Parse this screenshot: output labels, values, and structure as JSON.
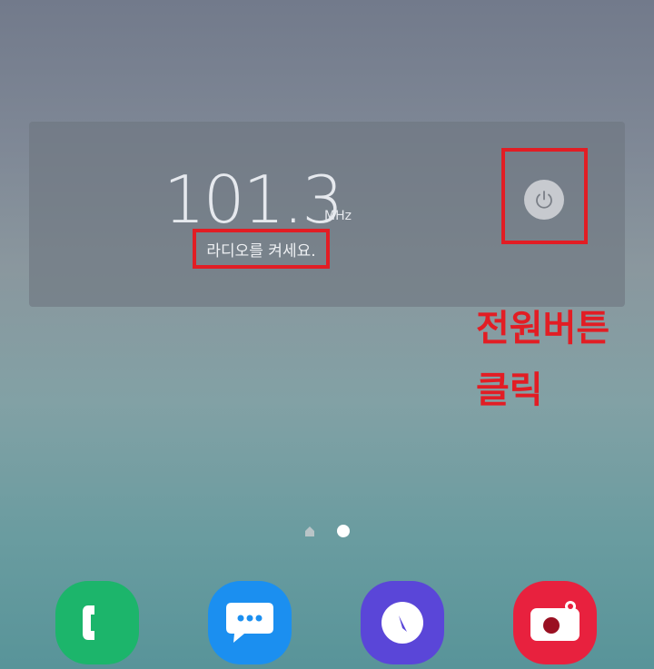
{
  "radio_widget": {
    "frequency": "101.3",
    "unit": "MHz",
    "status": "라디오를 켜세요."
  },
  "annotation": {
    "line1": "전원버튼",
    "line2": "클릭"
  },
  "page_indicator": {
    "pages": [
      "home",
      "page"
    ],
    "active_index": 1
  },
  "dock": {
    "apps": [
      "phone-icon",
      "messages-icon",
      "clock-icon",
      "camera-icon"
    ]
  },
  "colors": {
    "annotation_red": "#e21d24",
    "phone": "#1cb56b",
    "messages": "#1b8ff0",
    "clock": "#5a46d8",
    "camera": "#e8213e"
  }
}
